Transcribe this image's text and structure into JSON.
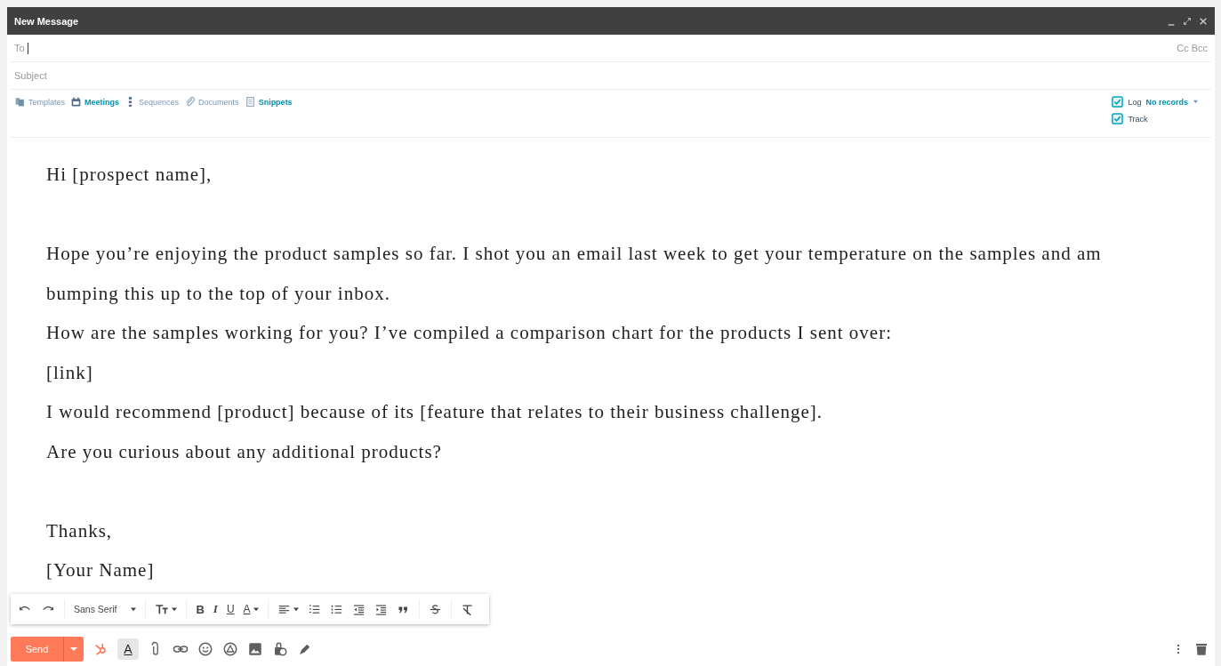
{
  "window": {
    "title": "New Message"
  },
  "to": {
    "label": "To",
    "cc": "Cc",
    "bcc": "Bcc"
  },
  "subject": {
    "placeholder": "Subject"
  },
  "tools": [
    {
      "label": "Templates",
      "active": false
    },
    {
      "label": "Meetings",
      "active": true
    },
    {
      "label": "Sequences",
      "active": false
    },
    {
      "label": "Documents",
      "active": false
    },
    {
      "label": "Snippets",
      "active": true
    }
  ],
  "log": {
    "label": "Log",
    "checked": true,
    "records": "No records"
  },
  "track": {
    "label": "Track",
    "checked": true
  },
  "body": [
    [
      "Hi [prospect name],"
    ],
    [
      "Hope you’re enjoying the product samples so far. I shot you an email last week to get your temperature on the samples and am bumping this up to the top of your inbox.",
      "How are the samples working for you? I’ve compiled a comparison chart for the products I sent over:",
      "[link]",
      "I would recommend [product] because of its [feature that relates to their business challenge].",
      "Are you curious about any additional products?"
    ],
    [
      "Thanks,",
      "[Your Name]"
    ]
  ],
  "format_toolbar": {
    "font": "Sans Serif",
    "bold": "B",
    "italic": "I",
    "underline": "U",
    "text_color": "A"
  },
  "send_bar": {
    "send": "Send",
    "formatting": "A",
    "formatting_on": true
  }
}
